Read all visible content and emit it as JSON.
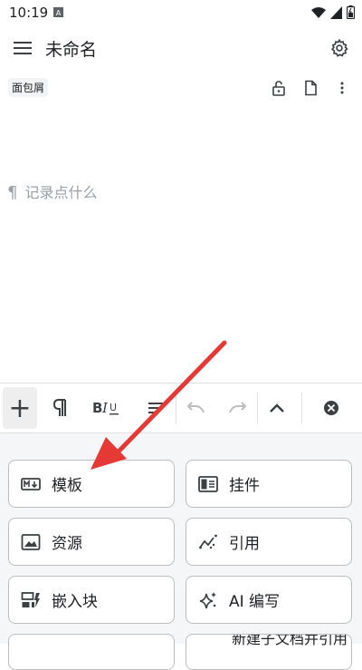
{
  "status_bar": {
    "time": "10:19",
    "badge": "A"
  },
  "app_bar": {
    "title": "未命名"
  },
  "sub_bar": {
    "breadcrumb": "面包屑"
  },
  "editor": {
    "placeholder": "记录点什么"
  },
  "toolbar": {
    "items": [
      "add-icon",
      "paragraph-icon",
      "bold-italic-underline-icon",
      "align-icon",
      "undo-icon",
      "redo-icon",
      "collapse-icon",
      "close-icon"
    ]
  },
  "panel": {
    "cards": [
      {
        "label": "模板"
      },
      {
        "label": "挂件"
      },
      {
        "label": "资源"
      },
      {
        "label": "引用"
      },
      {
        "label": "嵌入块"
      },
      {
        "label": "AI 编写"
      },
      {
        "label": "新建子文档并引用"
      }
    ]
  },
  "colors": {
    "accent_arrow": "#e53935",
    "border": "#bdbdbd",
    "panel_bg": "#f5f6f7"
  }
}
